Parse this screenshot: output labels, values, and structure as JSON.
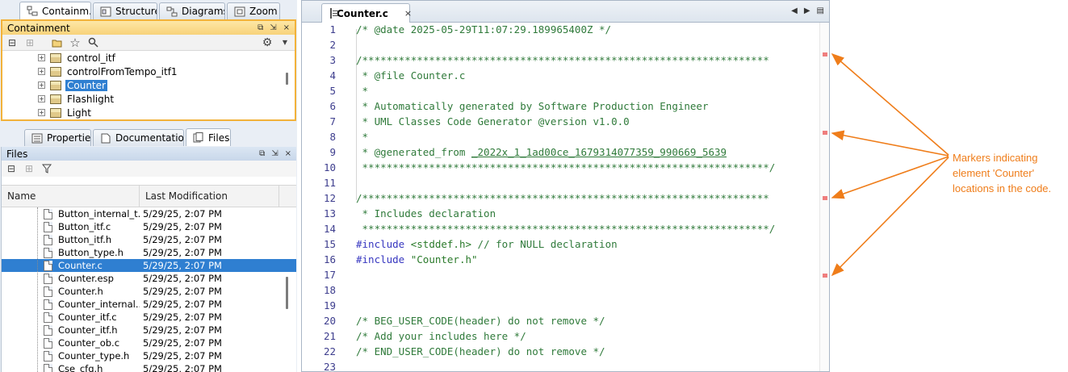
{
  "left_tabs": [
    {
      "label": "Containm...",
      "active": true
    },
    {
      "label": "Structure",
      "active": false
    },
    {
      "label": "Diagrams",
      "active": false
    },
    {
      "label": "Zoom",
      "active": false
    }
  ],
  "containment": {
    "title": "Containment",
    "items": [
      {
        "label": "control_itf",
        "selected": false
      },
      {
        "label": "controlFromTempo_itf1",
        "selected": false
      },
      {
        "label": "Counter",
        "selected": true
      },
      {
        "label": "Flashlight",
        "selected": false
      },
      {
        "label": "Light",
        "selected": false
      }
    ]
  },
  "bottom_tabs": [
    {
      "label": "Properties"
    },
    {
      "label": "Documentation"
    },
    {
      "label": "Files"
    }
  ],
  "files": {
    "title": "Files",
    "columns": {
      "name": "Name",
      "modified": "Last Modification"
    },
    "rows": [
      {
        "name": "Button_internal_t...",
        "modified": "5/29/25, 2:07 PM",
        "selected": false
      },
      {
        "name": "Button_itf.c",
        "modified": "5/29/25, 2:07 PM",
        "selected": false
      },
      {
        "name": "Button_itf.h",
        "modified": "5/29/25, 2:07 PM",
        "selected": false
      },
      {
        "name": "Button_type.h",
        "modified": "5/29/25, 2:07 PM",
        "selected": false
      },
      {
        "name": "Counter.c",
        "modified": "5/29/25, 2:07 PM",
        "selected": true
      },
      {
        "name": "Counter.esp",
        "modified": "5/29/25, 2:07 PM",
        "selected": false
      },
      {
        "name": "Counter.h",
        "modified": "5/29/25, 2:07 PM",
        "selected": false
      },
      {
        "name": "Counter_internal...",
        "modified": "5/29/25, 2:07 PM",
        "selected": false
      },
      {
        "name": "Counter_itf.c",
        "modified": "5/29/25, 2:07 PM",
        "selected": false
      },
      {
        "name": "Counter_itf.h",
        "modified": "5/29/25, 2:07 PM",
        "selected": false
      },
      {
        "name": "Counter_ob.c",
        "modified": "5/29/25, 2:07 PM",
        "selected": false
      },
      {
        "name": "Counter_type.h",
        "modified": "5/29/25, 2:07 PM",
        "selected": false
      },
      {
        "name": "Cse_cfg.h",
        "modified": "5/29/25, 2:07 PM",
        "selected": false
      }
    ]
  },
  "editor": {
    "tab_label": "Counter.c",
    "lines": [
      {
        "n": "1",
        "kind": "comment",
        "text": "/* @date 2025-05-29T11:07:29.189965400Z */"
      },
      {
        "n": "2",
        "kind": "comment",
        "text": ""
      },
      {
        "n": "3",
        "kind": "comment",
        "text": "/*******************************************************************"
      },
      {
        "n": "4",
        "kind": "comment",
        "text": " * @file Counter.c"
      },
      {
        "n": "5",
        "kind": "comment",
        "text": " *"
      },
      {
        "n": "6",
        "kind": "comment",
        "text": " * Automatically generated by Software Production Engineer"
      },
      {
        "n": "7",
        "kind": "comment",
        "text": " * UML Classes Code Generator @version v1.0.0"
      },
      {
        "n": "8",
        "kind": "comment",
        "text": " *"
      },
      {
        "n": "9",
        "kind": "link",
        "prefix": " * @generated_from ",
        "text": "_2022x_1_1ad00ce_1679314077359_990669_5639"
      },
      {
        "n": "10",
        "kind": "comment",
        "text": " *******************************************************************/"
      },
      {
        "n": "11",
        "kind": "comment",
        "text": ""
      },
      {
        "n": "12",
        "kind": "comment",
        "text": "/*******************************************************************"
      },
      {
        "n": "13",
        "kind": "comment",
        "text": " * Includes declaration"
      },
      {
        "n": "14",
        "kind": "comment",
        "text": " *******************************************************************/"
      },
      {
        "n": "15",
        "kind": "include",
        "directive": "#include",
        "arg": " <stddef.h>",
        "comment": " // for NULL declaration"
      },
      {
        "n": "16",
        "kind": "include",
        "directive": "#include",
        "arg": " \"Counter.h\"",
        "comment": ""
      },
      {
        "n": "17",
        "kind": "comment",
        "text": ""
      },
      {
        "n": "18",
        "kind": "comment",
        "text": ""
      },
      {
        "n": "19",
        "kind": "comment",
        "text": ""
      },
      {
        "n": "20",
        "kind": "comment",
        "text": "/* BEG_USER_CODE(header) do not remove */"
      },
      {
        "n": "21",
        "kind": "comment",
        "text": "/* Add your includes here */"
      },
      {
        "n": "22",
        "kind": "comment",
        "text": "/* END_USER_CODE(header) do not remove */"
      },
      {
        "n": "23",
        "kind": "comment",
        "text": ""
      }
    ],
    "marker_color": "#ef7e7e"
  },
  "annotation": {
    "text": "Markers indicating element 'Counter' locations in the code.",
    "color": "#ef7d1a"
  },
  "icons": {
    "close": "×",
    "star": "☆",
    "search": "🔍",
    "gear": "⚙"
  }
}
